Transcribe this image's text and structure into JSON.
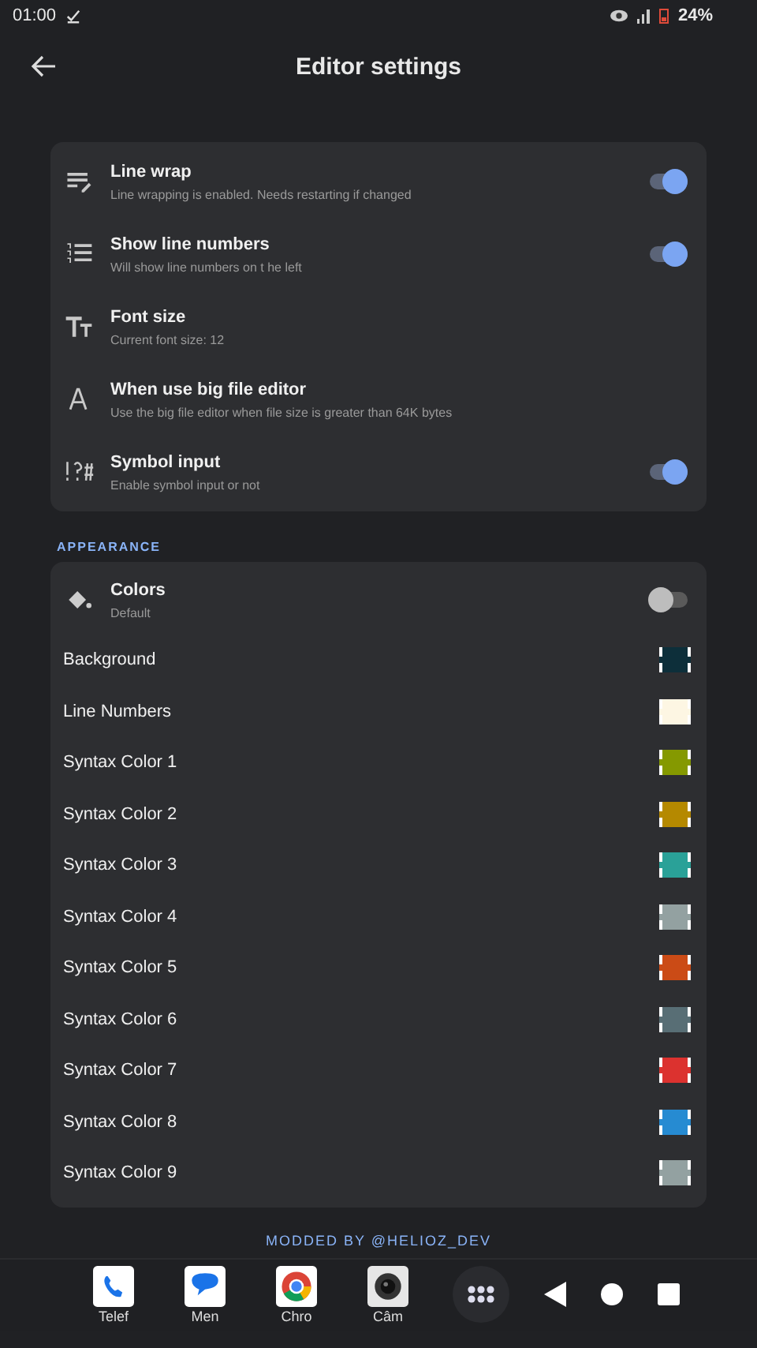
{
  "status_bar": {
    "time": "01:00",
    "battery": "24%"
  },
  "app_bar": {
    "title": "Editor settings"
  },
  "general": [
    {
      "title": "Line wrap",
      "summary": "Line wrapping is enabled. Needs restarting if changed",
      "kind": "switch",
      "on": true
    },
    {
      "title": "Show line numbers",
      "summary": "Will show line numbers on t he left",
      "kind": "switch",
      "on": true
    },
    {
      "title": "Font size",
      "summary": "Current font size: 12",
      "kind": "plain"
    },
    {
      "title": "When use big file editor",
      "summary": "Use the big file editor when file size is greater than 64K bytes",
      "kind": "plain"
    },
    {
      "title": "Symbol input",
      "summary": "Enable symbol input or not",
      "kind": "switch",
      "on": true
    }
  ],
  "appearance": {
    "header": "APPEARANCE",
    "colors_row": {
      "title": "Colors",
      "summary": "Default",
      "on": false
    },
    "colors": [
      {
        "label": "Background",
        "color": "#0d2f3a"
      },
      {
        "label": "Line Numbers",
        "color": "#fdf6e3"
      },
      {
        "label": "Syntax Color 1",
        "color": "#859900"
      },
      {
        "label": "Syntax Color 2",
        "color": "#b58900"
      },
      {
        "label": "Syntax Color 3",
        "color": "#2aa198"
      },
      {
        "label": "Syntax Color 4",
        "color": "#93a1a1"
      },
      {
        "label": "Syntax Color 5",
        "color": "#cb4b16"
      },
      {
        "label": "Syntax Color 6",
        "color": "#586e75"
      },
      {
        "label": "Syntax Color 7",
        "color": "#dc322f"
      },
      {
        "label": "Syntax Color 8",
        "color": "#268bd2"
      },
      {
        "label": "Syntax Color 9",
        "color": "#93a1a1"
      }
    ]
  },
  "footer": "MODDED BY @HELIOZ_DEV",
  "taskbar": [
    {
      "label": "Telef"
    },
    {
      "label": "Men"
    },
    {
      "label": "Chro"
    },
    {
      "label": "Câm"
    }
  ]
}
